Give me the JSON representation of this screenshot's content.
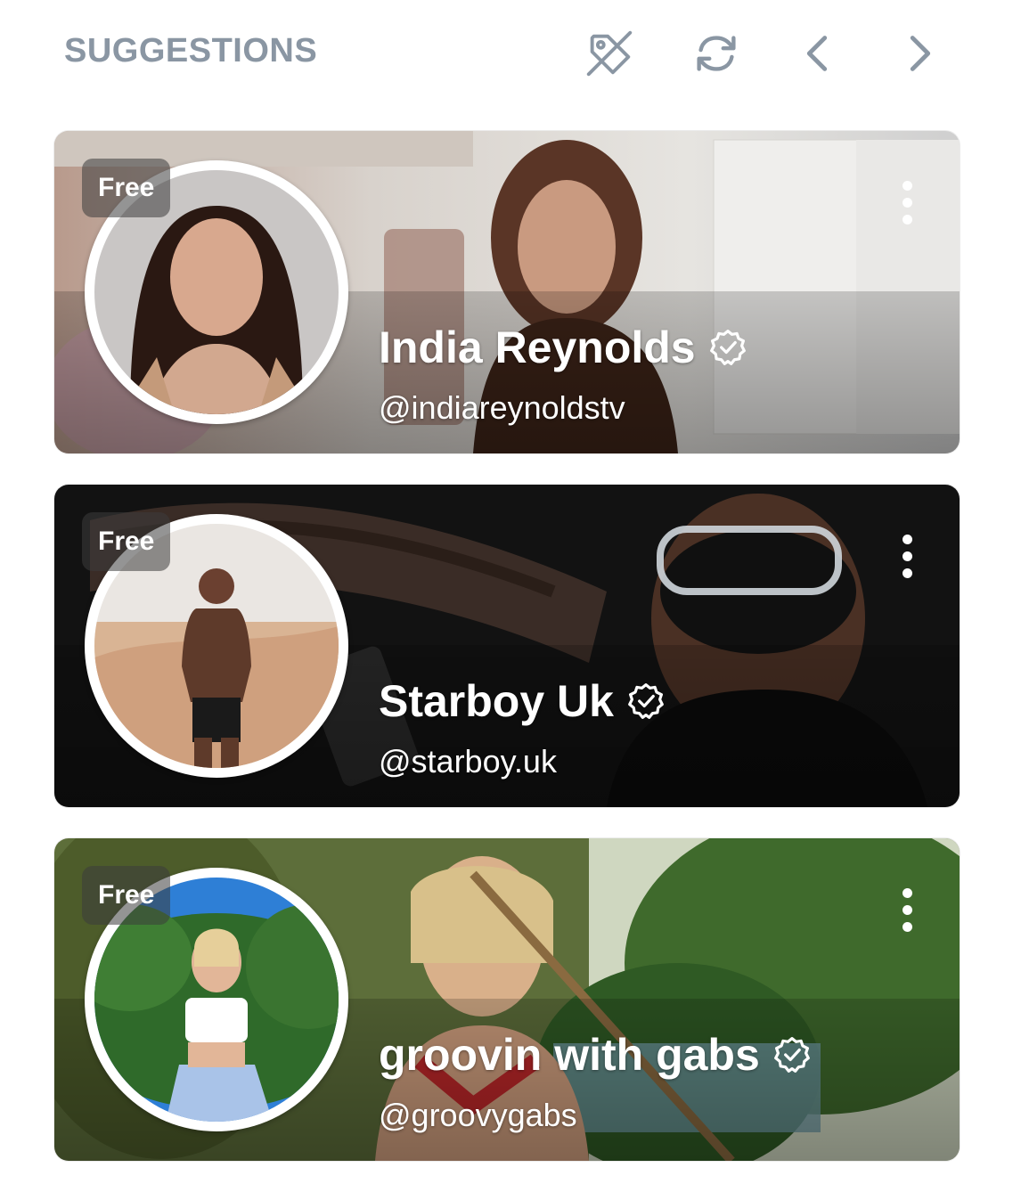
{
  "header": {
    "title": "SUGGESTIONS",
    "icons": [
      "price-tag-off-icon",
      "refresh-icon",
      "chevron-left-icon",
      "chevron-right-icon"
    ]
  },
  "colors": {
    "title": "#8a96a3",
    "icon": "#8a96a3",
    "text_on_card": "#ffffff"
  },
  "cards": [
    {
      "badge": "Free",
      "name": "India Reynolds",
      "handle": "@indiareynoldstv",
      "verified": true
    },
    {
      "badge": "Free",
      "name": "Starboy Uk",
      "handle": "@starboy.uk",
      "verified": true
    },
    {
      "badge": "Free",
      "name": "groovin with gabs",
      "handle": "@groovygabs",
      "verified": true
    }
  ]
}
